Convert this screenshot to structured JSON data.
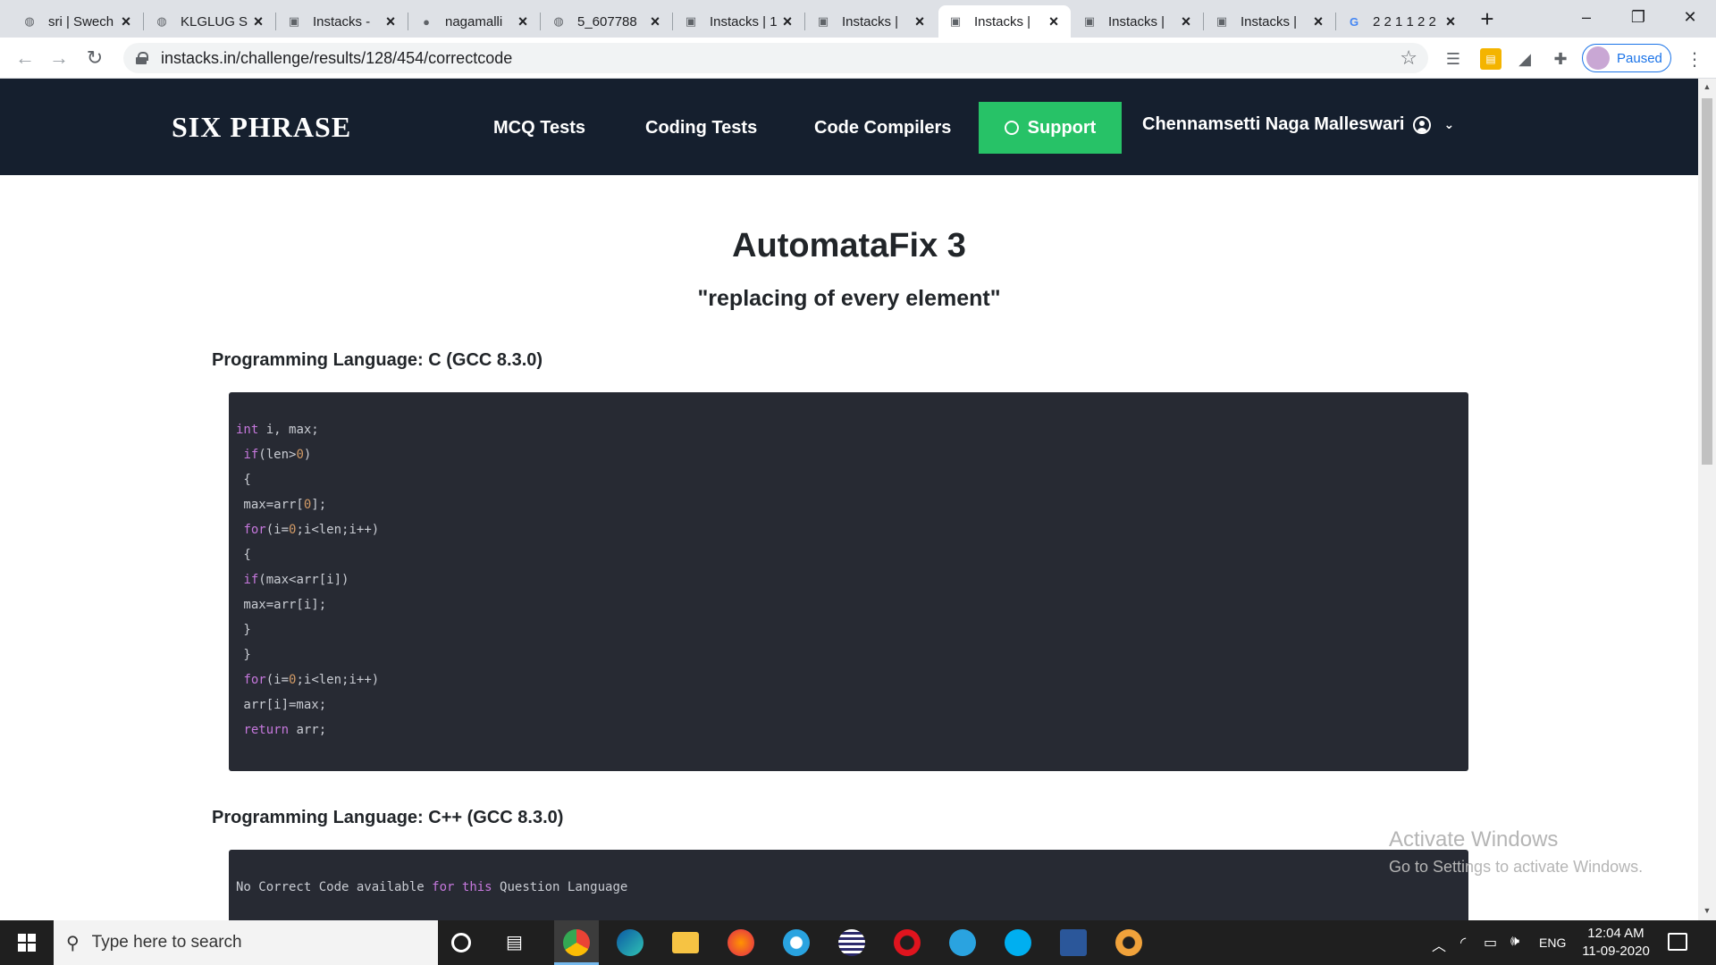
{
  "browser": {
    "tabs": [
      {
        "label": "sri | Swech",
        "icon": "globe-icon"
      },
      {
        "label": "KLGLUG S",
        "icon": "globe-icon"
      },
      {
        "label": "Instacks -",
        "icon": "instacks-icon"
      },
      {
        "label": "nagamalli",
        "icon": "github-icon"
      },
      {
        "label": "5_607788",
        "icon": "globe-icon"
      },
      {
        "label": "Instacks | 1",
        "icon": "instacks-icon"
      },
      {
        "label": "Instacks |",
        "icon": "instacks-icon"
      },
      {
        "label": "Instacks |",
        "icon": "instacks-icon",
        "active": true
      },
      {
        "label": "Instacks |",
        "icon": "instacks-icon"
      },
      {
        "label": "Instacks |",
        "icon": "instacks-icon"
      },
      {
        "label": "2 2 1 1 2 2",
        "icon": "google-icon"
      }
    ],
    "url": "instacks.in/challenge/results/128/454/correctcode",
    "profile_status": "Paused"
  },
  "site": {
    "brand": "SIX PHRASE",
    "nav": {
      "mcq": "MCQ Tests",
      "coding": "Coding Tests",
      "compilers": "Code Compilers",
      "support": "Support",
      "user": "Chennamsetti Naga Malleswari"
    },
    "accent": "#27c267",
    "navbar_bg": "#151f2e"
  },
  "page": {
    "title": "AutomataFix 3",
    "subtitle": "\"replacing of every element\"",
    "sections": [
      {
        "language": "Programming Language: C (GCC 8.3.0)",
        "code": [
          "int i, max;",
          " if(len>0)",
          " {",
          " max=arr[0];",
          " for(i=0;i<len;i++)",
          " {",
          " if(max<arr[i])",
          " max=arr[i];",
          " }",
          " }",
          " for(i=0;i<len;i++)",
          " arr[i]=max;",
          " return arr;"
        ]
      },
      {
        "language": "Programming Language: C++ (GCC 8.3.0)",
        "code": [
          "No Correct Code available for this Question Language"
        ]
      }
    ]
  },
  "watermark": {
    "line1": "Activate Windows",
    "line2": "Go to Settings to activate Windows."
  },
  "taskbar": {
    "search_placeholder": "Type here to search",
    "language": "ENG",
    "time": "12:04 AM",
    "date": "11-09-2020"
  }
}
